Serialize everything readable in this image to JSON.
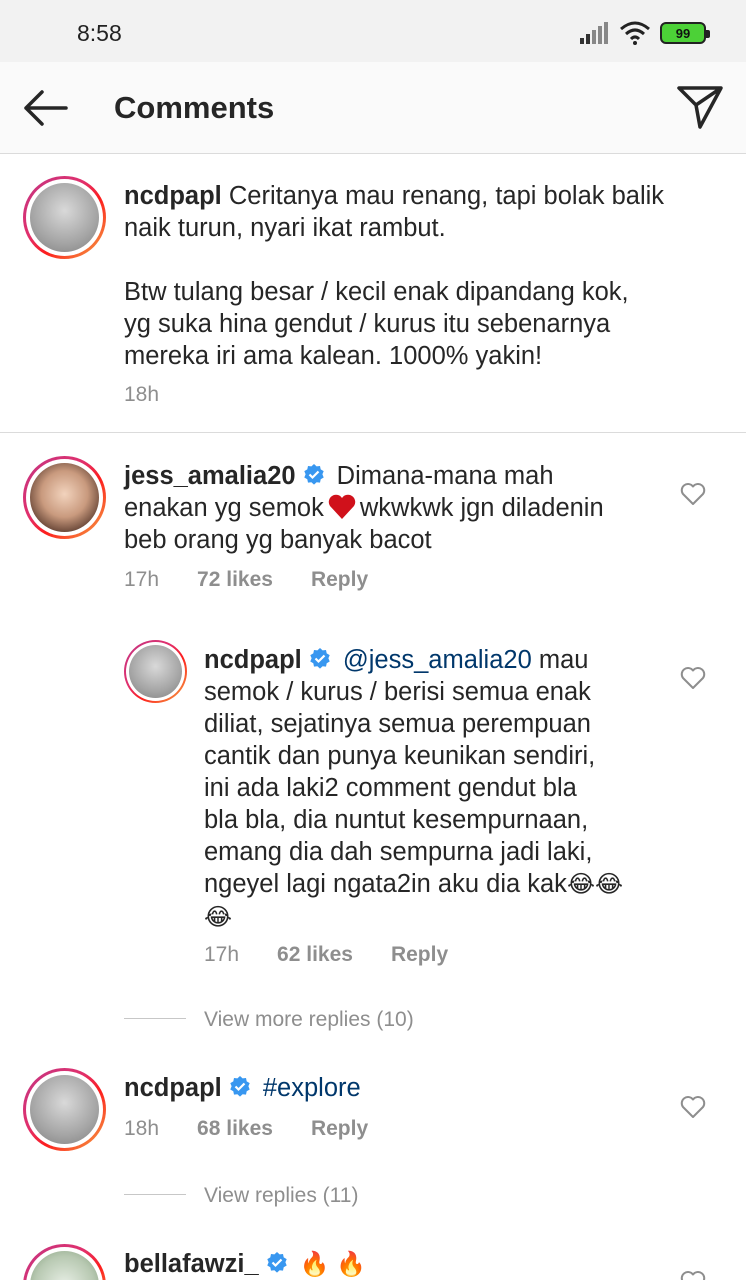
{
  "status_bar": {
    "time": "8:58",
    "battery": "99"
  },
  "header": {
    "title": "Comments"
  },
  "caption": {
    "username": "ncdpapl",
    "line1": "Ceritanya mau renang, tapi bolak balik",
    "line2": "naik turun, nyari ikat rambut.",
    "line3": "Btw tulang besar / kecil enak dipandang kok,",
    "line4": "yg suka hina gendut / kurus itu sebenarnya",
    "line5": "mereka iri ama kalean. 1000% yakin!",
    "time": "18h"
  },
  "comments": [
    {
      "username": "jess_amalia20",
      "line1": "Dimana-mana mah",
      "line2a": "enakan yg semok",
      "line2b": "wkwkwk jgn diladenin",
      "line3": "beb orang yg banyak bacot",
      "time": "17h",
      "likes": "72 likes",
      "reply": "Reply"
    },
    {
      "username": "ncdpapl",
      "mention": "@jess_amalia20",
      "line1": "mau",
      "line2": "semok / kurus / berisi semua enak",
      "line3": "diliat, sejatinya semua perempuan",
      "line4": "cantik dan punya keunikan sendiri,",
      "line5": "ini ada laki2 comment gendut bla",
      "line6": "bla bla, dia nuntut kesempurnaan,",
      "line7": "emang dia dah sempurna jadi laki,",
      "line8": "ngeyel lagi ngata2in aku dia kak",
      "time": "17h",
      "likes": "62 likes",
      "reply": "Reply"
    },
    {
      "username": "ncdpapl",
      "hashtag": "#explore",
      "time": "18h",
      "likes": "68 likes",
      "reply": "Reply"
    },
    {
      "username": "bellafawzi_"
    }
  ],
  "view_more_replies": "View more replies (10)",
  "view_replies": "View replies (11)",
  "icons": [
    "back-arrow-icon",
    "send-icon",
    "verified-badge-icon",
    "heart-icon",
    "signal-icon",
    "wifi-icon",
    "battery-icon"
  ],
  "colors": {
    "link": "#00376b",
    "verified": "#3897f0",
    "meta": "#8e8e8e"
  }
}
